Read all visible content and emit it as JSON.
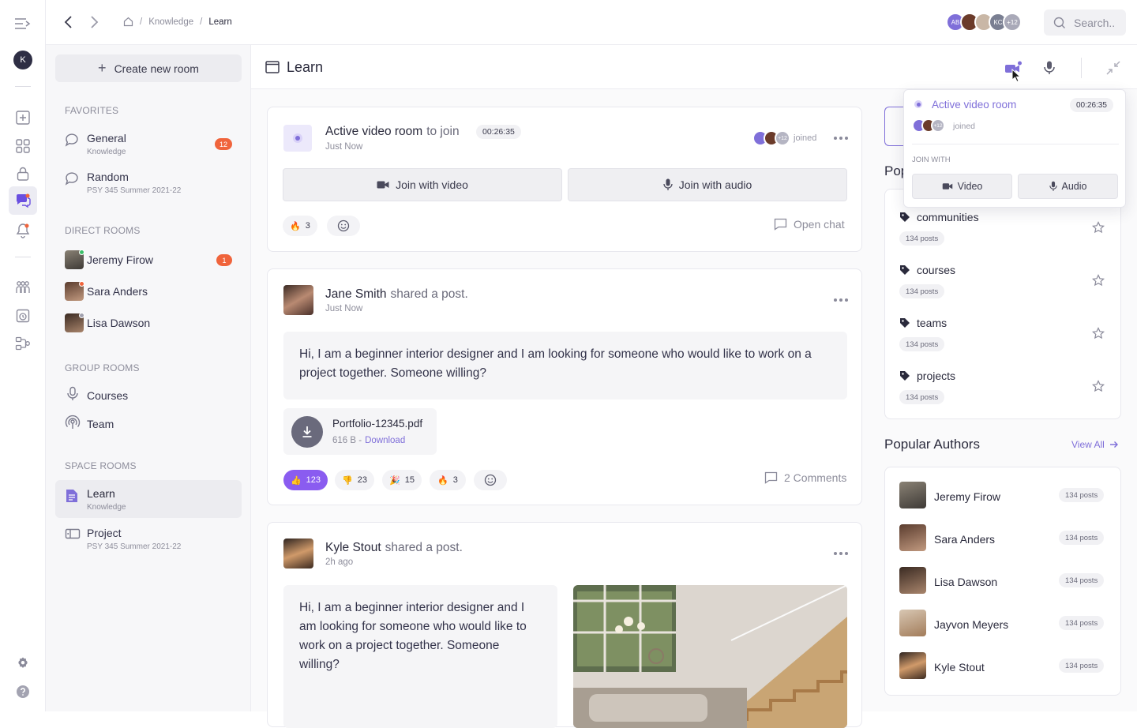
{
  "breadcrumb": {
    "items": [
      "Knowledge",
      "Learn"
    ]
  },
  "topbar": {
    "avatars": [
      {
        "initials": "AB",
        "color": "#7f6fd9"
      },
      {
        "initials": "",
        "color": "#6b3b2a"
      },
      {
        "initials": "",
        "color": "#c9b7a6"
      },
      {
        "initials": "KC",
        "color": "#7a7f92"
      },
      {
        "initials": "+12",
        "color": "#a9a9b8"
      }
    ],
    "search_placeholder": "Search.."
  },
  "rail": {
    "user_initial": "K"
  },
  "sidebar": {
    "create_label": "Create new room",
    "favorites_title": "FAVORITES",
    "favorites": [
      {
        "name": "General",
        "sub": "Knowledge",
        "badge": "12"
      },
      {
        "name": "Random",
        "sub": "PSY 345 Summer 2021-22",
        "badge": ""
      }
    ],
    "direct_title": "DIRECT ROOMS",
    "direct": [
      {
        "name": "Jeremy Firow",
        "badge": "1",
        "status": "#3cc06a"
      },
      {
        "name": "Sara Anders",
        "badge": "",
        "status": "#f0643c"
      },
      {
        "name": "Lisa Dawson",
        "badge": "",
        "status": "#a0a0ae"
      }
    ],
    "group_title": "GROUP ROOMS",
    "groups": [
      {
        "name": "Courses",
        "icon": "microphone-icon"
      },
      {
        "name": "Team",
        "icon": "broadcast-icon"
      }
    ],
    "space_title": "SPACE ROOMS",
    "spaces": [
      {
        "name": "Learn",
        "sub": "Knowledge"
      },
      {
        "name": "Project",
        "sub": "PSY 345 Summer 2021-22"
      }
    ]
  },
  "main": {
    "title": "Learn",
    "video_card": {
      "title": "Active video room",
      "suffix": "to join",
      "timer": "00:26:35",
      "time": "Just Now",
      "joined_count": "+12",
      "joined_label": "joined",
      "join_video": "Join with video",
      "join_audio": "Join with audio",
      "reaction_count": "3",
      "open_chat": "Open chat"
    },
    "post1": {
      "author": "Jane Smith",
      "action": "shared a post.",
      "time": "Just Now",
      "text": "Hi, I am a beginner interior designer and I am looking for someone who would like to work on a project together. Someone willing?",
      "file_name": "Portfolio-12345.pdf",
      "file_size": "616 B -",
      "download": "Download",
      "reactions": [
        {
          "emoji": "👍",
          "count": "123"
        },
        {
          "emoji": "👎",
          "count": "23"
        },
        {
          "emoji": "🎉",
          "count": "15"
        },
        {
          "emoji": "🔥",
          "count": "3"
        }
      ],
      "comments": "2 Comments"
    },
    "post2": {
      "author": "Kyle Stout",
      "action": "shared a post.",
      "time": "2h ago",
      "text": "Hi, I am a beginner interior designer and I am looking for someone who would like to work on a project together. Someone willing?"
    }
  },
  "right": {
    "popular_title_partial": "Pop",
    "tags": [
      {
        "name": "communities",
        "posts": "134 posts"
      },
      {
        "name": "courses",
        "posts": "134 posts"
      },
      {
        "name": "teams",
        "posts": "134 posts"
      },
      {
        "name": "projects",
        "posts": "134 posts"
      }
    ],
    "authors_title": "Popular Authors",
    "view_all": "View All",
    "authors": [
      {
        "name": "Jeremy Firow",
        "posts": "134 posts"
      },
      {
        "name": "Sara Anders",
        "posts": "134 posts"
      },
      {
        "name": "Lisa Dawson",
        "posts": "134 posts"
      },
      {
        "name": "Jayvon Meyers",
        "posts": "134 posts"
      },
      {
        "name": "Kyle Stout",
        "posts": "134 posts"
      }
    ]
  },
  "popover": {
    "title": "Active video room",
    "timer": "00:26:35",
    "count": "+12",
    "joined": "joined",
    "join_with": "JOIN WITH",
    "video": "Video",
    "audio": "Audio"
  },
  "colors": {
    "accent": "#8a5cf0",
    "badge": "#f0643c"
  }
}
